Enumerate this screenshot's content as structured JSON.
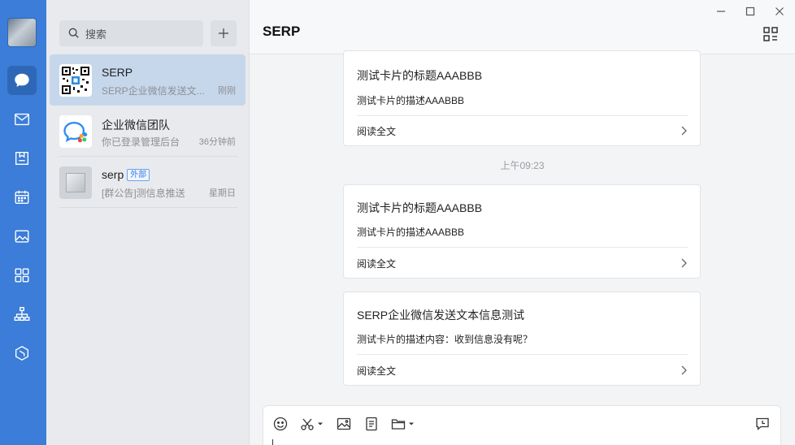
{
  "nav": {
    "items": [
      {
        "icon": "chat-icon",
        "active": true
      },
      {
        "icon": "mail-icon"
      },
      {
        "icon": "document-icon"
      },
      {
        "icon": "calendar-icon"
      },
      {
        "icon": "image-icon"
      },
      {
        "icon": "apps-icon"
      },
      {
        "icon": "org-chart-icon"
      },
      {
        "icon": "cube-icon"
      }
    ]
  },
  "search": {
    "placeholder": "搜索"
  },
  "sessions": [
    {
      "name": "SERP",
      "preview": "SERP企业微信发送文...",
      "time": "刚刚",
      "active": true
    },
    {
      "name": "企业微信团队",
      "preview": "你已登录管理后台",
      "time": "36分钟前"
    },
    {
      "name": "serp",
      "tag": "外部",
      "preview": "[群公告]测信息推送",
      "time": "星期日"
    }
  ],
  "chat": {
    "title": "SERP",
    "read_more_label": "阅读全文",
    "time_separator": "上午09:23",
    "cards": [
      {
        "title": "测试卡片的标题AAABBB",
        "desc": "测试卡片的描述AAABBB"
      },
      {
        "title": "测试卡片的标题AAABBB",
        "desc": "测试卡片的描述AAABBB"
      },
      {
        "title": "SERP企业微信发送文本信息测试",
        "desc": "测试卡片的描述内容：收到信息没有呢？"
      }
    ]
  },
  "colors": {
    "accent": "#3b7dd8",
    "active_session": "#c6d7ec",
    "tag": "#3a7de0"
  }
}
